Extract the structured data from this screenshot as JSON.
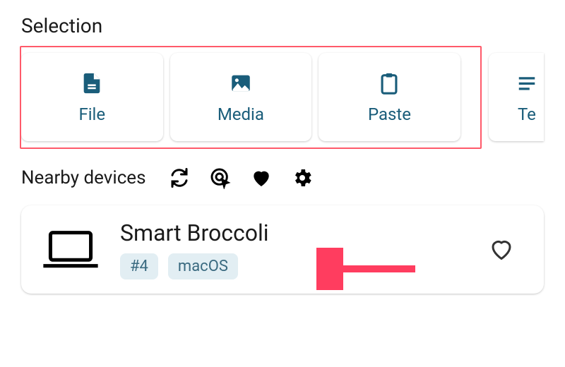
{
  "selection": {
    "title": "Selection",
    "tiles": [
      {
        "label": "File"
      },
      {
        "label": "Media"
      },
      {
        "label": "Paste"
      },
      {
        "label": "Te"
      }
    ]
  },
  "devices": {
    "title": "Nearby devices",
    "list": [
      {
        "name": "Smart Broccoli",
        "id_badge": "#4",
        "os_badge": "macOS"
      }
    ]
  },
  "colors": {
    "accent": "#1a5d7a",
    "highlight": "#ff5a6a",
    "arrow": "#ff3d5f"
  }
}
